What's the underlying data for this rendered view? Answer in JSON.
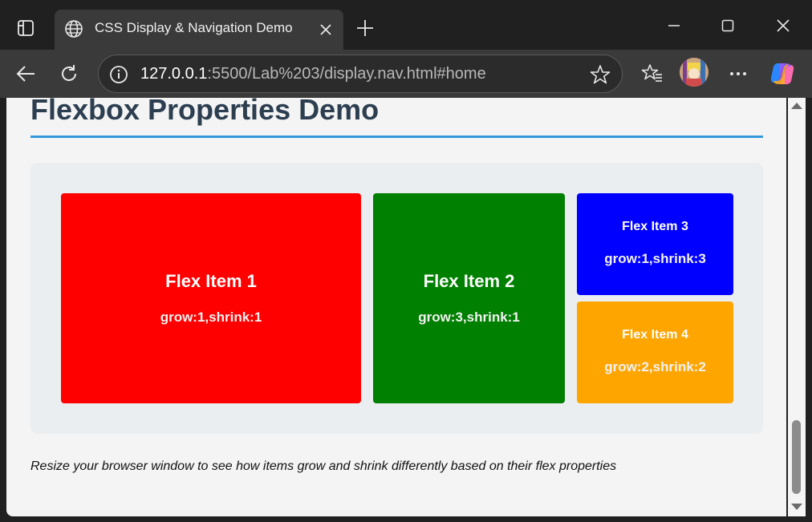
{
  "browser": {
    "tab_title": "CSS Display & Navigation Demo",
    "url_host": "127.0.0.1",
    "url_rest": ":5500/Lab%203/display.nav.html#home",
    "icons": [
      "tab-actions-icon",
      "globe-icon",
      "close-icon",
      "plus-icon",
      "minimize-icon",
      "maximize-icon",
      "window-close-icon",
      "back-arrow-icon",
      "refresh-icon",
      "info-icon",
      "star-icon",
      "favorites-icon",
      "more-icon",
      "copilot-icon"
    ]
  },
  "page": {
    "title": "Flexbox Properties Demo",
    "accent_color": "#3498db",
    "title_color": "#2c3e50",
    "items": [
      {
        "name": "Flex Item 1",
        "props": "grow:1,shrink:1",
        "color": "#ff0000"
      },
      {
        "name": "Flex Item 2",
        "props": "grow:3,shrink:1",
        "color": "#008000"
      },
      {
        "name": "Flex Item 3",
        "props": "grow:1,shrink:3",
        "color": "#0000ff"
      },
      {
        "name": "Flex Item 4",
        "props": "grow:2,shrink:2",
        "color": "#ffa500"
      }
    ],
    "caption": "Resize your browser window to see how items grow and shrink differently based on their flex properties"
  }
}
